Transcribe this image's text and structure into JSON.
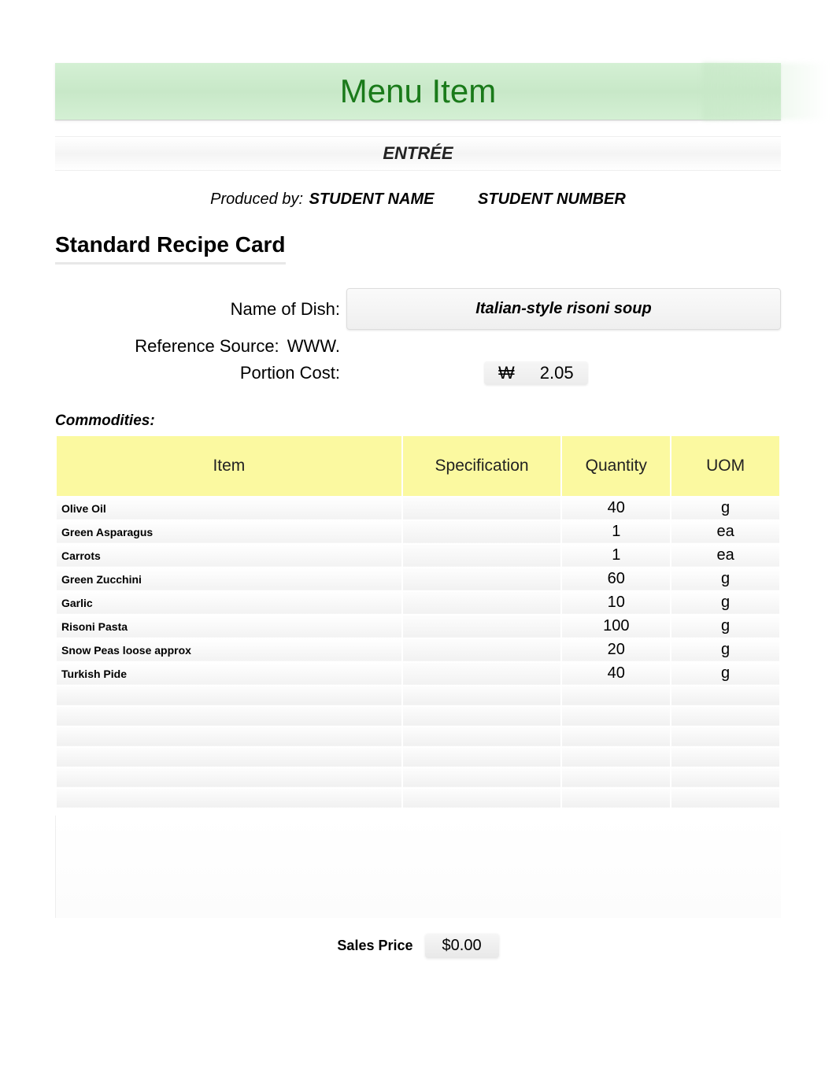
{
  "header": {
    "menu_title": "Menu Item",
    "course": "ENTRÉE",
    "produced_by_label": "Produced by:",
    "student_name": "STUDENT NAME",
    "student_number": "STUDENT NUMBER"
  },
  "recipe": {
    "card_title": "Standard Recipe Card",
    "name_label": "Name of Dish:",
    "dish_name": "Italian-style risoni soup",
    "reference_label": "Reference Source:",
    "reference_value": "WWW.",
    "portion_label": "Portion Cost:",
    "portion_currency": "₩",
    "portion_value": "2.05"
  },
  "commodities": {
    "label": "Commodities:",
    "columns": {
      "item": "Item",
      "spec": "Specification",
      "qty": "Quantity",
      "uom": "UOM"
    },
    "rows": [
      {
        "item": "Olive Oil",
        "spec": "",
        "qty": "40",
        "uom": "g"
      },
      {
        "item": "Green Asparagus",
        "spec": "",
        "qty": "1",
        "uom": "ea"
      },
      {
        "item": "Carrots",
        "spec": "",
        "qty": "1",
        "uom": "ea"
      },
      {
        "item": "Green Zucchini",
        "spec": "",
        "qty": "60",
        "uom": "g"
      },
      {
        "item": "Garlic",
        "spec": "",
        "qty": "10",
        "uom": "g"
      },
      {
        "item": "Risoni Pasta",
        "spec": "",
        "qty": "100",
        "uom": "g"
      },
      {
        "item": "Snow Peas loose approx",
        "spec": "",
        "qty": "20",
        "uom": "g"
      },
      {
        "item": "Turkish Pide",
        "spec": "",
        "qty": "40",
        "uom": "g"
      }
    ]
  },
  "sales": {
    "label": "Sales Price",
    "value": "$0.00"
  }
}
